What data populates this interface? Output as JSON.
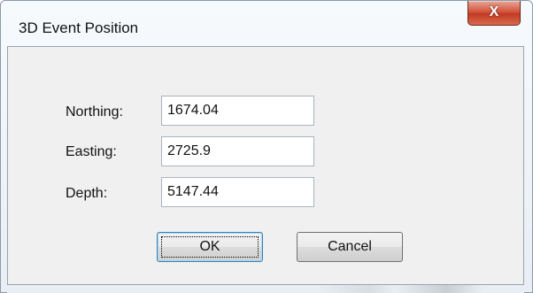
{
  "window": {
    "title": "3D Event Position",
    "close_glyph": "X"
  },
  "form": {
    "northing_label": "Northing:",
    "northing_value": "1674.04",
    "easting_label": "Easting:",
    "easting_value": "2725.9",
    "depth_label": "Depth:",
    "depth_value": "5147.44"
  },
  "buttons": {
    "ok_label": "OK",
    "cancel_label": "Cancel"
  },
  "icons": {
    "close": "close-icon"
  }
}
